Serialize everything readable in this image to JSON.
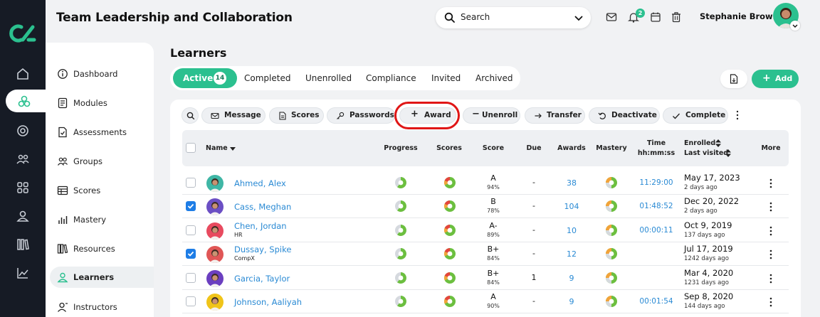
{
  "app": {
    "title": "Team Leadership and Collaboration",
    "brand_color": "#2bc08f"
  },
  "header": {
    "search_placeholder": "Search",
    "notification_count": "2",
    "user_name": "Stephanie Brown",
    "icons": [
      "search-icon",
      "chevron-down-icon",
      "mail-icon",
      "bell-icon",
      "calendar-icon",
      "trash-icon"
    ]
  },
  "rail": {
    "icons": [
      "home-icon",
      "modules-icon",
      "target-icon",
      "groups-icon",
      "grid-icon",
      "user-icon",
      "library-icon",
      "chart-icon"
    ]
  },
  "sidebar": {
    "items": [
      {
        "label": "Dashboard",
        "icon": "info-icon"
      },
      {
        "label": "Modules",
        "icon": "document-icon"
      },
      {
        "label": "Assessments",
        "icon": "file-check-icon"
      },
      {
        "label": "Groups",
        "icon": "groups-icon"
      },
      {
        "label": "Scores",
        "icon": "table-icon"
      },
      {
        "label": "Mastery",
        "icon": "bar-chart-icon"
      },
      {
        "label": "Resources",
        "icon": "books-icon"
      },
      {
        "label": "Learners",
        "icon": "user-icon",
        "active": true
      },
      {
        "label": "Instructors",
        "icon": "instructor-icon"
      }
    ]
  },
  "learners": {
    "title": "Learners",
    "tabs": [
      {
        "label": "Active",
        "count": "14",
        "active": true
      },
      {
        "label": "Completed"
      },
      {
        "label": "Unenrolled"
      },
      {
        "label": "Compliance"
      },
      {
        "label": "Invited"
      },
      {
        "label": "Archived"
      }
    ],
    "add_label": "Add",
    "actions": [
      {
        "label": "Message",
        "icon": "mail-icon"
      },
      {
        "label": "Scores",
        "icon": "document-icon"
      },
      {
        "label": "Passwords",
        "icon": "key-icon"
      },
      {
        "label": "Award",
        "icon": "plus-icon",
        "highlighted": true
      },
      {
        "label": "Unenroll",
        "icon": "minus-icon"
      },
      {
        "label": "Transfer",
        "icon": "arrow-right-icon"
      },
      {
        "label": "Deactivate",
        "icon": "undo-icon"
      },
      {
        "label": "Complete",
        "icon": "check-icon"
      }
    ],
    "columns": {
      "name": "Name",
      "progress": "Progress",
      "scores": "Scores",
      "score": "Score",
      "due": "Due",
      "awards": "Awards",
      "mastery": "Mastery",
      "time": "Time",
      "time_unit": "hh:mm:ss",
      "enrolled": "Enrolled",
      "last_visited": "Last visited",
      "more": "More"
    },
    "rows": [
      {
        "name": "Ahmed, Alex",
        "org": "",
        "checked": false,
        "grade": "A",
        "percent": "94%",
        "due": "-",
        "awards": "38",
        "time": "11:29:00",
        "enrolled": "May 17, 2023",
        "last_visited": "2 days ago",
        "avatar_color": "#3fb6a5"
      },
      {
        "name": "Cass, Meghan",
        "org": "",
        "checked": true,
        "grade": "B",
        "percent": "78%",
        "due": "-",
        "awards": "104",
        "time": "01:48:52",
        "enrolled": "Dec 20, 2022",
        "last_visited": "2 days ago",
        "avatar_color": "#6b4fc4"
      },
      {
        "name": "Chen, Jordan",
        "org": "HR",
        "checked": false,
        "grade": "A-",
        "percent": "89%",
        "due": "-",
        "awards": "10",
        "time": "00:00:11",
        "enrolled": "Oct 9, 2019",
        "last_visited": "137 days ago",
        "avatar_color": "#e84a5f"
      },
      {
        "name": "Dussay, Spike",
        "org": "CompX",
        "checked": true,
        "grade": "B+",
        "percent": "84%",
        "due": "-",
        "awards": "12",
        "time": "",
        "enrolled": "Jul 17, 2019",
        "last_visited": "1242 days ago",
        "avatar_color": "#e05656"
      },
      {
        "name": "Garcia, Taylor",
        "org": "",
        "checked": false,
        "grade": "B+",
        "percent": "84%",
        "due": "1",
        "awards": "9",
        "time": "",
        "enrolled": "Mar 4, 2020",
        "last_visited": "1231 days ago",
        "avatar_color": "#6b3fc0"
      },
      {
        "name": "Johnson, Aaliyah",
        "org": "",
        "checked": false,
        "grade": "A",
        "percent": "90%",
        "due": "-",
        "awards": "9",
        "time": "00:01:54",
        "enrolled": "Sep 8, 2020",
        "last_visited": "144 days ago",
        "avatar_color": "#f0c419"
      }
    ]
  }
}
